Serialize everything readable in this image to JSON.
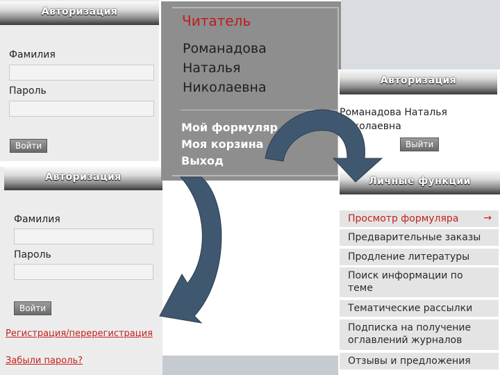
{
  "auth_top": {
    "header": "Авторизация",
    "surname_label": "Фамилия",
    "password_label": "Пароль",
    "login_button": "Войти"
  },
  "auth_bottom": {
    "header": "Авторизация",
    "surname_label": "Фамилия",
    "password_label": "Пароль",
    "login_button": "Войти",
    "register_link": "Регистрация/перерегистрация",
    "forgot_link": "Забыли пароль?"
  },
  "reader": {
    "title": "Читатель",
    "name_lines": [
      "Романадова",
      "Наталья",
      "Николаевна"
    ],
    "menu": [
      "Мой формуляр",
      "Моя корзина",
      "Выход"
    ]
  },
  "auth_logged": {
    "header": "Авторизация",
    "user_name_line1": "Романадова Наталья",
    "user_name_line2": "Николаевна",
    "logout_button": "Выйти"
  },
  "personal": {
    "header": "Личные функции",
    "items": [
      {
        "label": "Просмотр формуляра",
        "active": true
      },
      {
        "label": "Предварительные заказы"
      },
      {
        "label": "Продление литературы"
      },
      {
        "label": "Поиск информации по теме"
      },
      {
        "label": "Тематические рассылки"
      },
      {
        "label": "Подписка на получение оглавлений журналов"
      },
      {
        "label": "Отзывы и предложения"
      }
    ],
    "active_arrow": "→"
  },
  "colors": {
    "accent_red": "#c4201d",
    "reader_bg": "#8e8e8e",
    "arrow_fill": "#3f5870"
  }
}
